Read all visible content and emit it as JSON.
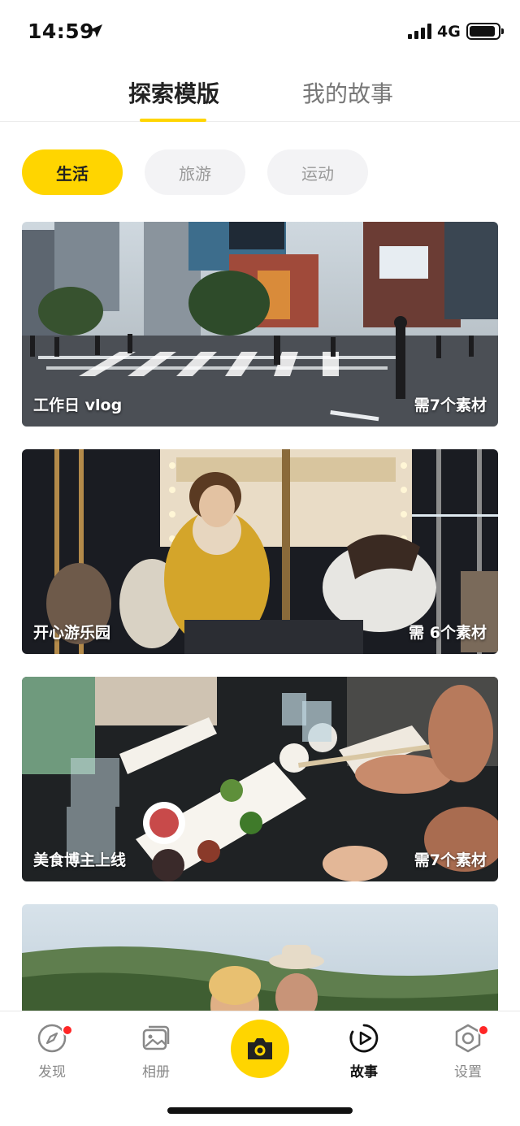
{
  "status_bar": {
    "time": "14:59",
    "network": "4G",
    "battery_level": 0.9
  },
  "top_tabs": {
    "active": "探索模版",
    "inactive": "我的故事"
  },
  "categories": [
    {
      "label": "生活",
      "selected": true
    },
    {
      "label": "旅游",
      "selected": false
    },
    {
      "label": "运动",
      "selected": false
    }
  ],
  "cards": [
    {
      "title": "工作日 vlog",
      "count": "需7个素材"
    },
    {
      "title": "开心游乐园",
      "count": "需 6个素材"
    },
    {
      "title": "美食博主上线",
      "count": "需7个素材"
    },
    {
      "title": "",
      "count": ""
    }
  ],
  "bottom_nav": {
    "discover": "发现",
    "album": "相册",
    "story": "故事",
    "settings": "设置"
  },
  "colors": {
    "accent": "#ffd500",
    "notification": "#ff2626"
  }
}
